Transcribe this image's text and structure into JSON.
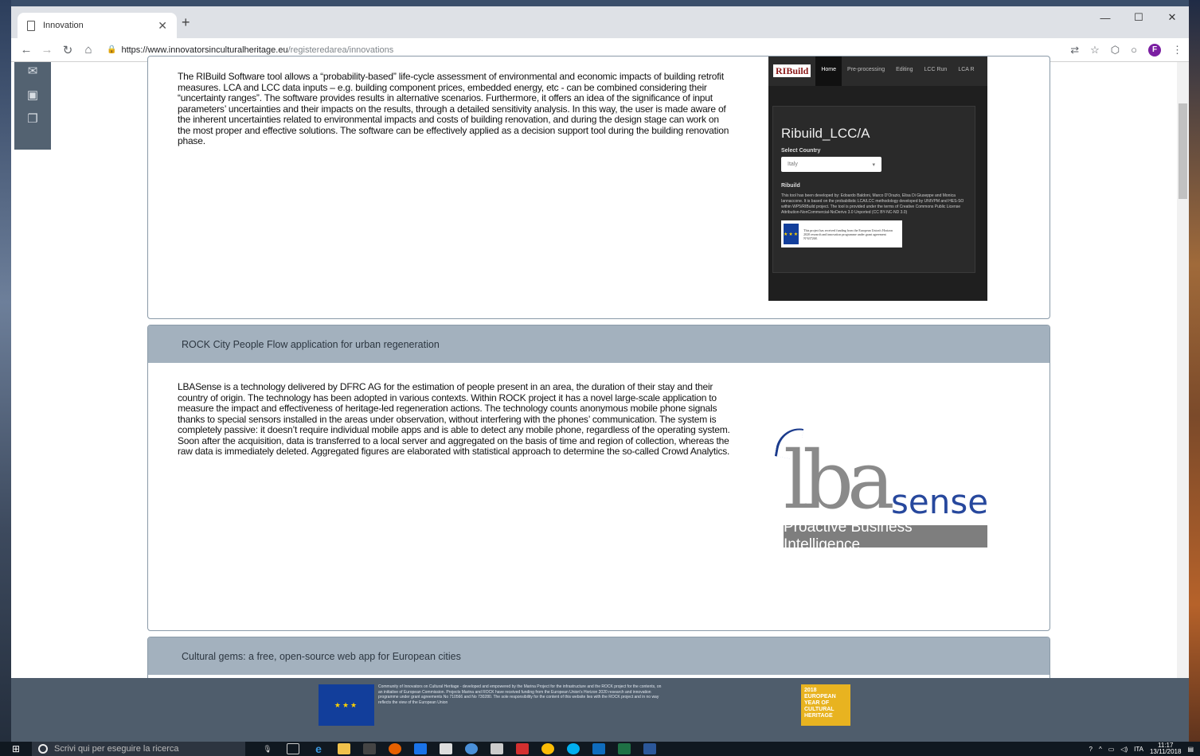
{
  "browser": {
    "tab_title": "Innovation",
    "url_host": "https://www.innovatorsinculturalheritage.eu",
    "url_path": "/registeredarea/innovations",
    "profile_initial": "F"
  },
  "cards": [
    {
      "title": "",
      "description": "The RIBuild Software tool allows a “probability-based” life-cycle assessment of environmental and economic impacts of building retrofit measures. LCA and LCC data inputs – e.g. building component prices, embedded energy, etc - can be combined considering their “uncertainty ranges”. The software provides results in alternative scenarios. Furthermore, it offers an idea of the significance of input parameters’ uncertainties and their impacts on the results, through a detailed sensitivity analysis. In this way, the user is made aware of the inherent uncertainties related to environmental impacts and costs of building renovation, and during the design stage can work on the most proper and effective solutions. The software can be effectively applied as a decision support tool during the building renovation phase.",
      "image": {
        "logo": "RIBuild",
        "nav": [
          "Home",
          "Pre-processing",
          "Editing",
          "LCC Run",
          "LCA R"
        ],
        "app_title": "Ribuild_LCC/A",
        "select_label": "Select Country",
        "select_value": "Italy",
        "section": "Ribuild",
        "text": "This tool has been developed by: Edoardo Baldoni, Marco D'Orazio, Elisa Di Giuseppe and Monica Iannaccone. It is based on the probabilistic LCA/LCC methodology developed by UNIVPM and HES-SO within WP5/RIBuild project. The tool is provided under the terms of Creative Commons Public License Attribution-NonCommercial-NoDerivs 3.0 Unported (CC BY-NC-ND 3.0)",
        "eu_text": "This project has received funding from the European Union's Horizon 2020 research and innovation programme under grant agreement N°637268."
      }
    },
    {
      "title": "ROCK City People Flow application for urban regeneration",
      "description": "LBASense is a technology delivered by DFRC AG for the estimation of people present in an area, the duration of their stay and their country of origin. The technology has been adopted in various contexts. Within ROCK project it has a novel large-scale application to measure the impact and effectiveness of heritage-led regeneration actions. The technology counts anonymous mobile phone signals thanks to special sensors installed in the areas under observation, without interfering with the phones’ communication. The system is completely passive: it doesn’t require individual mobile apps and is able to detect any mobile phone, regardless of the operating system. Soon after the acquisition, data is transferred to a local server and aggregated on the basis of time and region of collection, whereas the raw data is immediately deleted. Aggregated figures are elaborated with statistical approach to determine the so-called Crowd Analytics.",
      "image": {
        "logo_main": "lba",
        "logo_accent": "sense",
        "tagline": "Proactive Business Intelligence"
      }
    },
    {
      "title": "Cultural gems: a free, open-source web app for European cities"
    }
  ],
  "footer": {
    "text": "Community of Innovators on Cultural Heritage - developed and empowered by the Marina Project for the infrastructure and the ROCK project for the contents, on an initiative of European Commission. Projects Marina and ROCK have received funding from the European Union's Horizon 2020 research and innovation programme under grant agreements No 710566 and No 730280. The sole responsibility for the content of this website lies with the ROCK project and in no way reflects the view of the European Union",
    "badge": "2018 EUROPEAN YEAR OF CULTURAL HERITAGE"
  },
  "taskbar": {
    "search_placeholder": "Scrivi qui per eseguire la ricerca",
    "lang": "ITA",
    "time": "11:17",
    "date": "13/11/2018"
  }
}
